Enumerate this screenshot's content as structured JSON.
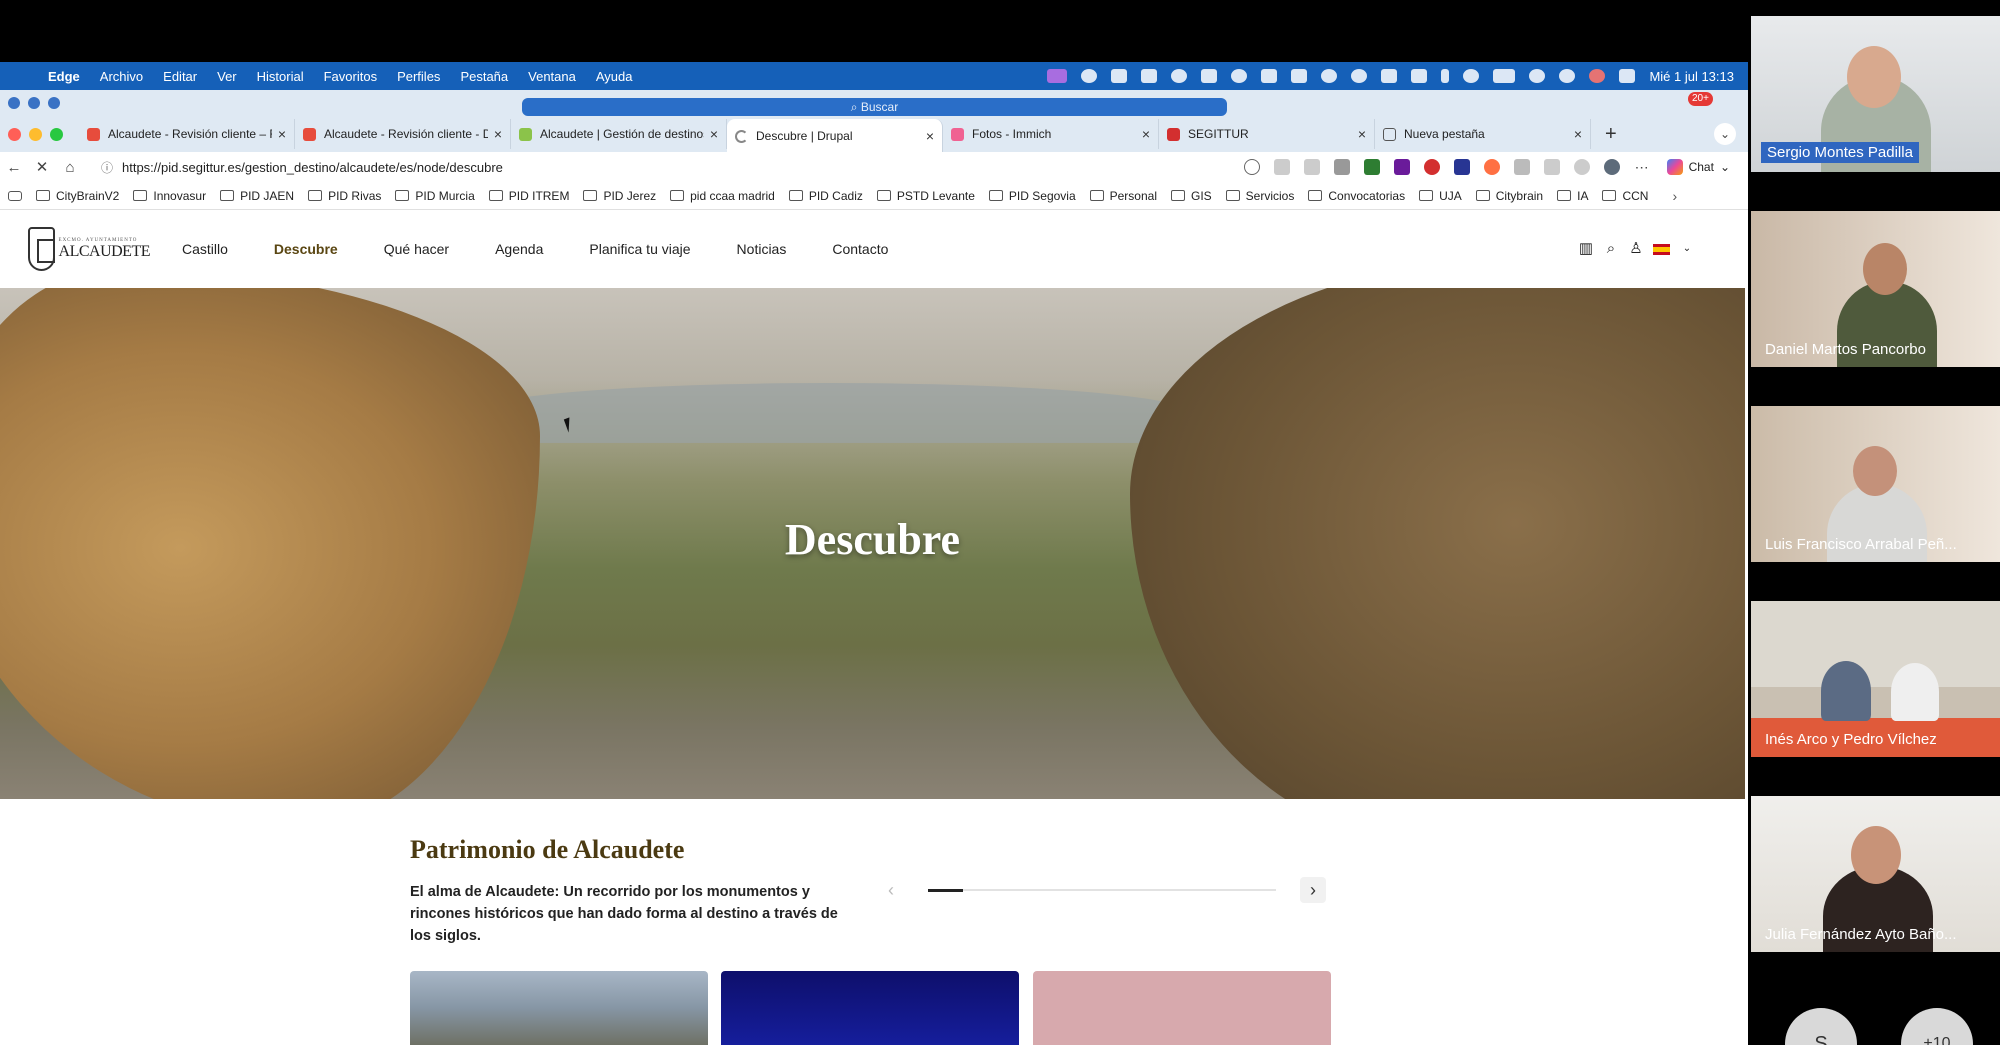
{
  "menubar": {
    "app": "Edge",
    "items": [
      "Archivo",
      "Editar",
      "Ver",
      "Historial",
      "Favoritos",
      "Perfiles",
      "Pestaña",
      "Ventana",
      "Ayuda"
    ],
    "clock": "Mié 1 jul 13:13"
  },
  "browser": {
    "search_pill": "Buscar",
    "notification_badge": "20+",
    "tabs": [
      {
        "label": "Alcaudete - Revisión cliente – F",
        "favicon_color": "#e74c3c"
      },
      {
        "label": "Alcaudete - Revisión cliente - D",
        "favicon_color": "#e74c3c"
      },
      {
        "label": "Alcaudete | Gestión de destinos",
        "favicon_color": "#8bc34a"
      },
      {
        "label": "Descubre | Drupal",
        "favicon_color": "#888888",
        "active": true
      },
      {
        "label": "Fotos - Immich",
        "favicon_color": "#f06292"
      },
      {
        "label": "SEGITTUR",
        "favicon_color": "#d32f2f"
      },
      {
        "label": "Nueva pestaña",
        "favicon_color": "#555555"
      }
    ],
    "new_tab": "+",
    "url": "https://pid.segittur.es/gestion_destino/alcaudete/es/node/descubre",
    "chat_label": "Chat",
    "bookmarks": [
      "CityBrainV2",
      "Innovasur",
      "PID JAEN",
      "PID Rivas",
      "PID Murcia",
      "PID ITREM",
      "PID Jerez",
      "pid ccaa madrid",
      "PID Cadiz",
      "PSTD Levante",
      "PID Segovia",
      "Personal",
      "GIS",
      "Servicios",
      "Convocatorias",
      "UJA",
      "Citybrain",
      "IA",
      "CCN"
    ]
  },
  "site": {
    "logo_small": "EXCMO. AYUNTAMIENTO",
    "logo_text": "ALCAUDETE",
    "nav": [
      {
        "label": "Castillo",
        "active": false
      },
      {
        "label": "Descubre",
        "active": true
      },
      {
        "label": "Qué hacer",
        "active": false
      },
      {
        "label": "Agenda",
        "active": false
      },
      {
        "label": "Planifica tu viaje",
        "active": false
      },
      {
        "label": "Noticias",
        "active": false
      },
      {
        "label": "Contacto",
        "active": false
      }
    ],
    "hero_title": "Descubre",
    "section_title": "Patrimonio de Alcaudete",
    "section_text": "El alma de Alcaudete: Un recorrido por los monumentos y rincones históricos que han dado forma al destino a través de los siglos.",
    "carousel_progress": 0.1,
    "accent_color": "#4b3a12"
  },
  "participants": [
    {
      "name": "Sergio Montes Padilla",
      "highlighted": true
    },
    {
      "name": "Daniel Martos Pancorbo",
      "highlighted": false
    },
    {
      "name": "Luis Francisco Arrabal Peñ...",
      "highlighted": false
    },
    {
      "name": "Inés Arco y Pedro Vílchez",
      "highlighted": false
    },
    {
      "name": "Julia Fernández Ayto Baño...",
      "highlighted": false
    }
  ],
  "extra_participants": {
    "initial": "S",
    "more_count": "+10"
  }
}
